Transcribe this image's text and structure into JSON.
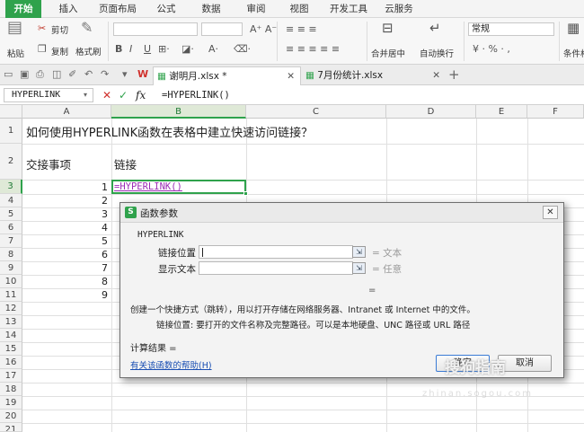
{
  "ribbon_tabs": [
    "开始",
    "插入",
    "页面布局",
    "公式",
    "数据",
    "审阅",
    "视图",
    "开发工具",
    "云服务"
  ],
  "ribbon": {
    "paste": "粘贴",
    "cut": "剪切",
    "copy": "复制",
    "format_painter": "格式刷",
    "merge_center": "合并居中",
    "wrap_text": "自动换行",
    "number_format": "常规",
    "percent_glyphs": "¥ · % · ,",
    "cond_format": "条件格"
  },
  "documents": [
    {
      "name": "谢明月.xlsx *",
      "active": true
    },
    {
      "name": "7月份统计.xlsx",
      "active": false
    }
  ],
  "formula_bar": {
    "name_box": "HYPERLINK",
    "formula": "=HYPERLINK()"
  },
  "columns": [
    "A",
    "B",
    "C",
    "D",
    "E",
    "F"
  ],
  "rows": [
    "1",
    "2",
    "3",
    "4",
    "5",
    "6",
    "7",
    "8",
    "9",
    "10",
    "11",
    "12",
    "13",
    "14",
    "15",
    "16",
    "17",
    "18",
    "19",
    "20",
    "21"
  ],
  "cells": {
    "title": "如何使用HYPERLINK函数在表格中建立快速访问链接？",
    "a2": "交接事项",
    "b2": "链接",
    "a_numbers": [
      "1",
      "2",
      "3",
      "4",
      "5",
      "6",
      "7",
      "8",
      "9"
    ],
    "b3": "=HYPERLINK()"
  },
  "dialog": {
    "title": "函数参数",
    "function_name": "HYPERLINK",
    "arg1_label": "链接位置",
    "arg1_result": "= 文本",
    "arg2_label": "显示文本",
    "arg2_result": "= 任意",
    "eq": "=",
    "description": "创建一个快捷方式（跳转），用以打开存储在网络服务器、Intranet 或 Internet 中的文件。",
    "arg_description": "链接位置:  要打开的文件名称及完整路径。可以是本地硬盘、UNC 路径或 URL 路径",
    "calc_result": "计算结果 =",
    "help_link": "有关该函数的帮助(H)",
    "ok": "确定",
    "cancel": "取消"
  },
  "watermark": "搜狗指南",
  "watermark_sub": "zhinan.sogou.com",
  "colors": {
    "accent": "#2fa24c",
    "link_purple": "#9b2cb6",
    "help_blue": "#1a4fb3"
  }
}
